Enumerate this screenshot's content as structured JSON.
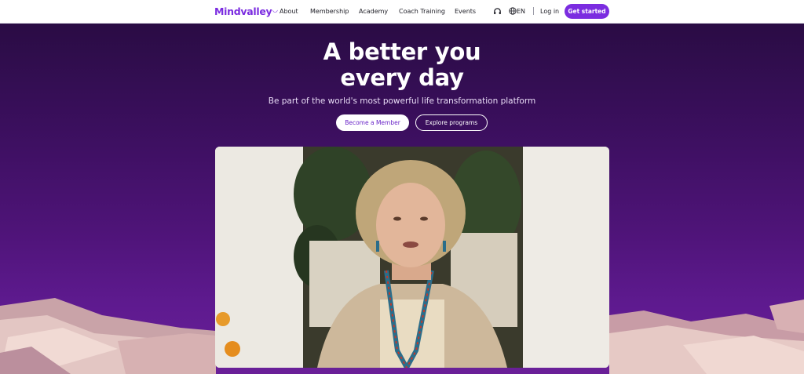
{
  "nav": {
    "logo": "Mindvalley",
    "links": [
      "About",
      "Membership",
      "Academy",
      "Coach Training",
      "Events"
    ],
    "language": "EN",
    "login": "Log in",
    "cta": "Get started"
  },
  "hero": {
    "title_line1": "A better you",
    "title_line2": "every day",
    "subtitle": "Be part of the world's most powerful life transformation platform",
    "primary_button": "Become a Member",
    "secondary_button": "Explore programs"
  },
  "icons": {
    "headset": "headset-icon",
    "globe": "globe-icon",
    "logo_mark": "logo-swoosh-icon"
  },
  "colors": {
    "brand": "#7b2ce0",
    "hero_top": "#2a0c44",
    "hero_bottom": "#6a2098"
  }
}
